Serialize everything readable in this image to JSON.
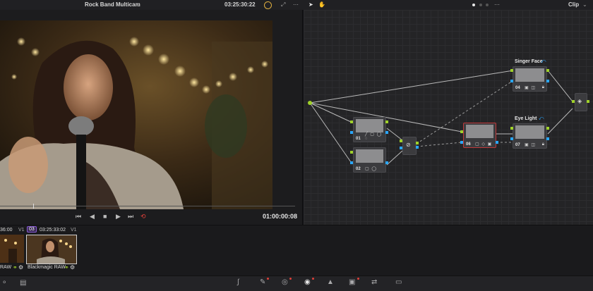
{
  "topbar": {
    "project_title": "Rock Band Multicam",
    "timecode": "03:25:30:22",
    "mode_label": "Clip"
  },
  "viewer": {
    "current_timecode": "01:00:00:08"
  },
  "nodes": [
    {
      "id": "04",
      "label": "Singer Face"
    },
    {
      "id": "07",
      "label": "Eye Light"
    },
    {
      "id": "01",
      "label": ""
    },
    {
      "id": "02",
      "label": ""
    },
    {
      "id": "06",
      "label": ""
    }
  ],
  "strip": {
    "left_timecode": "36:00",
    "left_track": "V1",
    "clip_badge": "03",
    "clip_timecode": "03:25:33:02",
    "clip_track": "V1",
    "left_clip_label": "RAW",
    "clip_label": "Blackmagic RAW"
  },
  "colors": {
    "accent_red": "#e0403a",
    "node_selected": "#c0383a",
    "port_green": "#9fd12a",
    "port_blue": "#2aa7ff",
    "badge_purple": "#8a5bd6"
  }
}
